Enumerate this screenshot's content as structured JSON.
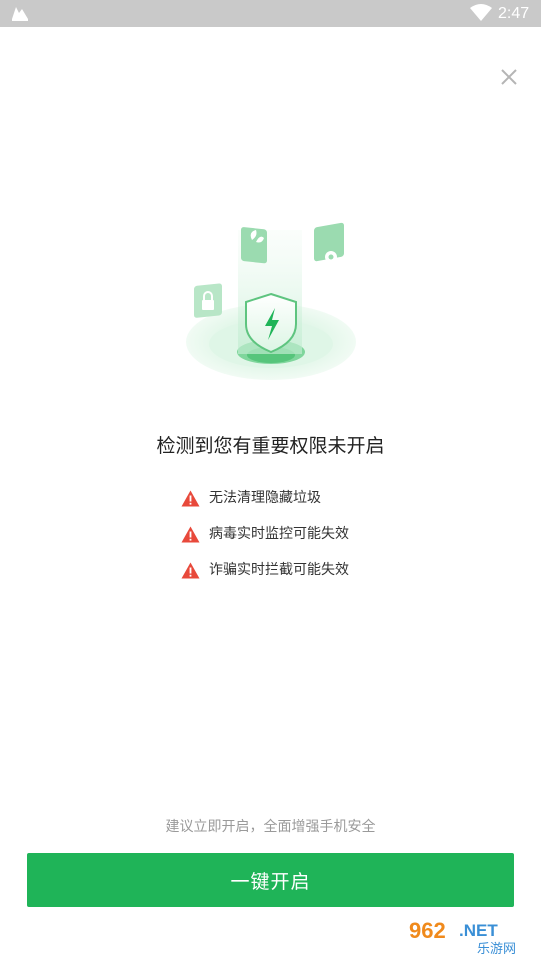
{
  "status_bar": {
    "time": "2:47",
    "left_icon": "android-icon",
    "right_icon": "wifi-icon"
  },
  "dialog": {
    "close_icon": "close-icon",
    "title": "检测到您有重要权限未开启",
    "warnings": [
      {
        "icon": "warning-icon",
        "text": "无法清理隐藏垃圾"
      },
      {
        "icon": "warning-icon",
        "text": "病毒实时监控可能失效"
      },
      {
        "icon": "warning-icon",
        "text": "诈骗实时拦截可能失效"
      }
    ],
    "hint": "建议立即开启，全面增强手机安全",
    "button_label": "一键开启"
  },
  "watermark": {
    "logo_text": "962.NET",
    "logo_sub": "乐游网"
  },
  "colors": {
    "accent": "#1fb458",
    "warning": "#e8493b",
    "status_bar": "#c9c9c9"
  }
}
